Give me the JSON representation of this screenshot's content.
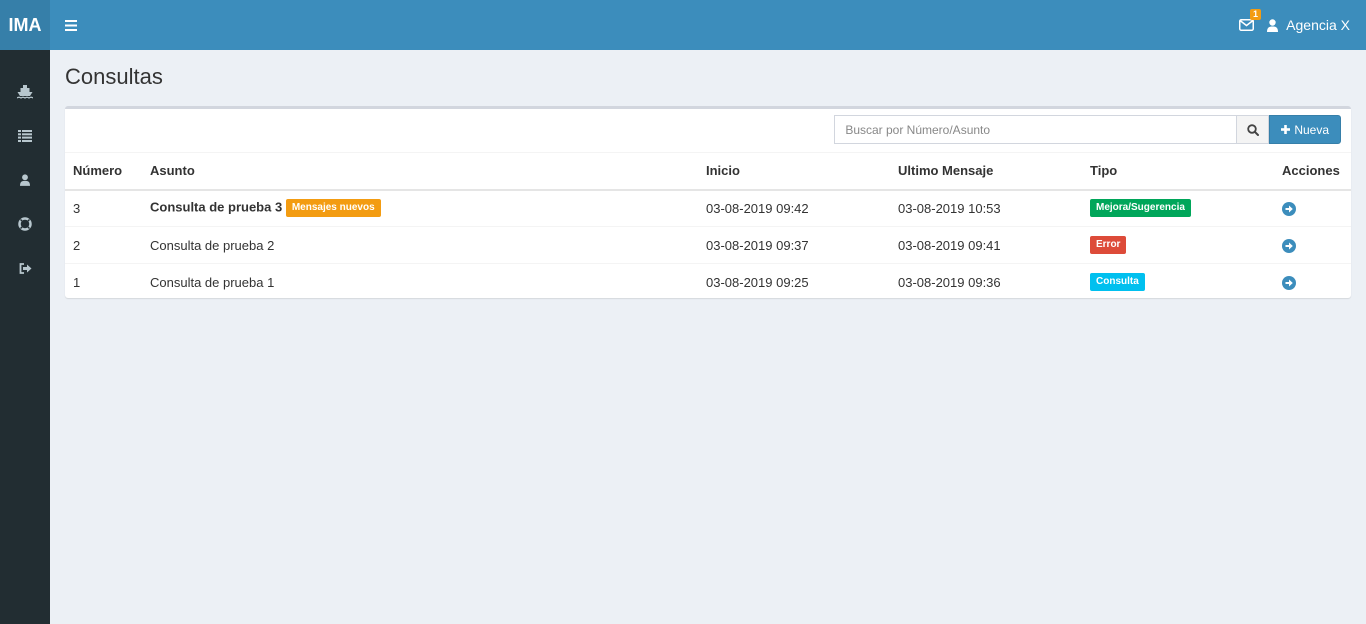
{
  "app": {
    "logo": "IMA"
  },
  "header": {
    "mail_count": "1",
    "user_name": "Agencia X"
  },
  "sidebar": {
    "items": [
      {
        "icon": "ship-icon"
      },
      {
        "icon": "list-icon"
      },
      {
        "icon": "user-icon"
      },
      {
        "icon": "life-ring-icon"
      },
      {
        "icon": "sign-out-icon"
      }
    ]
  },
  "page": {
    "title": "Consultas"
  },
  "search": {
    "placeholder": "Buscar por Número/Asunto",
    "value": ""
  },
  "toolbar": {
    "new_label": "Nueva"
  },
  "table": {
    "headers": {
      "numero": "Número",
      "asunto": "Asunto",
      "inicio": "Inicio",
      "ultimo": "Ultimo Mensaje",
      "tipo": "Tipo",
      "acciones": "Acciones"
    },
    "rows": [
      {
        "numero": "3",
        "asunto": "Consulta de prueba 3",
        "badge": "Mensajes nuevos",
        "inicio": "03-08-2019 09:42",
        "ultimo": "03-08-2019 10:53",
        "tipo": "Mejora/Sugerencia"
      },
      {
        "numero": "2",
        "asunto": "Consulta de prueba 2",
        "inicio": "03-08-2019 09:37",
        "ultimo": "03-08-2019 09:41",
        "tipo": "Error"
      },
      {
        "numero": "1",
        "asunto": "Consulta de prueba 1",
        "inicio": "03-08-2019 09:25",
        "ultimo": "03-08-2019 09:36",
        "tipo": "Consulta"
      }
    ]
  },
  "colors": {
    "header": "#3c8dbc",
    "logo_bg": "#367fa9",
    "sidebar": "#222d32",
    "badge_new": "#f39c12",
    "tipo_mejora": "#00a65a",
    "tipo_error": "#dd4b39",
    "tipo_consulta": "#00c0ef"
  }
}
